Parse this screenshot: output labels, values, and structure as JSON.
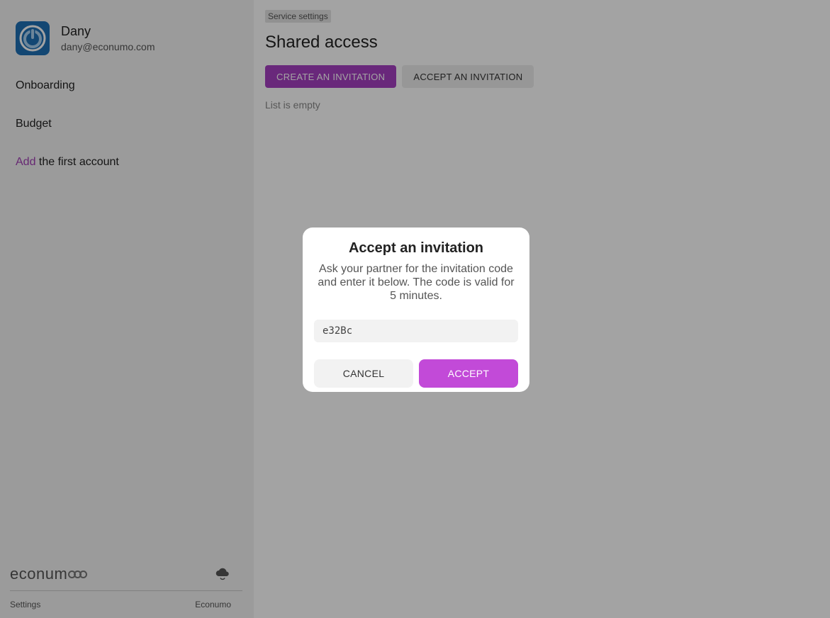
{
  "user": {
    "name": "Dany",
    "email": "dany@econumo.com"
  },
  "sidebar": {
    "items": [
      {
        "label": "Onboarding"
      },
      {
        "label": "Budget"
      }
    ],
    "add_account": {
      "link": "Add",
      "rest": " the first account"
    },
    "logo_text": "econum",
    "footer": {
      "left": "Settings",
      "right": "Econumo"
    }
  },
  "main": {
    "breadcrumb": "Service settings",
    "title": "Shared access",
    "create_button": "CREATE AN INVITATION",
    "accept_button": "ACCEPT AN INVITATION",
    "empty_text": "List is empty"
  },
  "dialog": {
    "title": "Accept an invitation",
    "text": "Ask your partner for the invitation code and enter it below. The code is valid for 5 minutes.",
    "code_value": "e32Bc",
    "cancel_label": "CANCEL",
    "accept_label": "ACCEPT"
  },
  "colors": {
    "accent": "#a53fc0",
    "accept": "#c24ad8",
    "avatar": "#1f6fb5"
  },
  "icons": {
    "avatar": "power-icon",
    "sync": "cloud-sync-icon"
  }
}
